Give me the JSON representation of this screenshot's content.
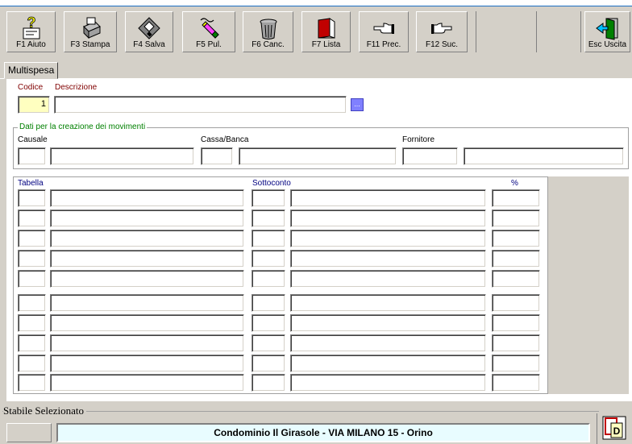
{
  "toolbar": {
    "buttons": [
      {
        "label": "F1 Aiuto",
        "icon": "help-icon"
      },
      {
        "label": "F3 Stampa",
        "icon": "printer-icon"
      },
      {
        "label": "F4 Salva",
        "icon": "floppy-disk-icon"
      },
      {
        "label": "F5 Pul.",
        "icon": "eraser-icon"
      },
      {
        "label": "F6 Canc.",
        "icon": "trash-bin-icon"
      },
      {
        "label": "F7 Lista",
        "icon": "book-list-icon"
      },
      {
        "label": "F11 Prec.",
        "icon": "hand-left-icon"
      },
      {
        "label": "F12 Suc.",
        "icon": "hand-right-icon"
      },
      {
        "label": "Esc Uscita",
        "icon": "exit-door-icon"
      }
    ]
  },
  "tab": {
    "label": "Multispesa"
  },
  "header": {
    "codice_label": "Codice",
    "descrizione_label": "Descrizione",
    "codice_value": "1",
    "descrizione_value": "",
    "lookup_label": "..."
  },
  "movimenti": {
    "group_title": "Dati per la creazione dei movimenti",
    "causale_label": "Causale",
    "cassa_label": "Cassa/Banca",
    "fornitore_label": "Fornitore"
  },
  "grid": {
    "col_tabella": "Tabella",
    "col_sottoconto": "Sottoconto",
    "col_percent": "%"
  },
  "status": {
    "title": "Stabile Selezionato",
    "condominio": "Condominio Il Girasole - VIA MILANO 15 - Orino",
    "pdf_icon": "pdf-icon"
  },
  "colors": {
    "toolbar": "#d4d0c8",
    "label_red": "#800000",
    "label_green": "#008000",
    "label_blue": "#000080",
    "banner": "#e8fcff"
  }
}
